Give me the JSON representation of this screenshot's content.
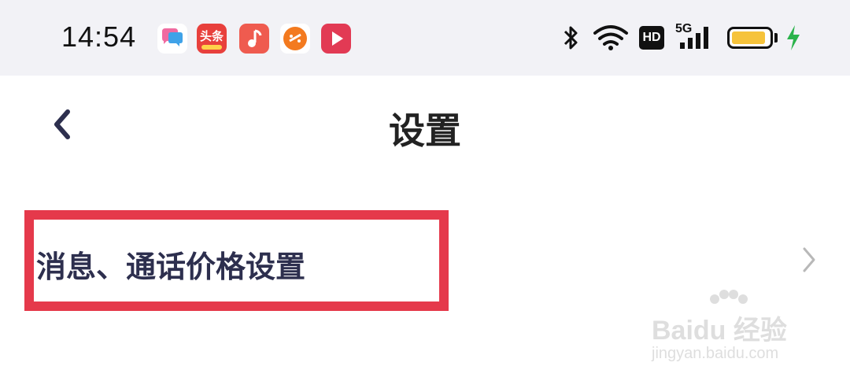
{
  "status_bar": {
    "time": "14:54",
    "apps": [
      {
        "name": "message-app",
        "color": "#ffffff"
      },
      {
        "name": "toutiao-app",
        "label": "头条",
        "color": "#e8403c"
      },
      {
        "name": "music-app",
        "color": "#ef5b4f"
      },
      {
        "name": "video-app",
        "color": "#ffffff"
      },
      {
        "name": "player-app",
        "color": "#e23a54"
      }
    ],
    "hd_label": "HD",
    "network_label": "5G",
    "battery_level": 0.92,
    "battery_color": "#f6c33b",
    "charging_color": "#2bb34b"
  },
  "nav": {
    "title": "设置"
  },
  "settings": {
    "items": [
      {
        "label": "消息、通话价格设置"
      }
    ]
  },
  "annotation": {
    "highlight_color": "#e5394b"
  },
  "watermark": {
    "brand": "Baidu 经验",
    "url": "jingyan.baidu.com"
  }
}
